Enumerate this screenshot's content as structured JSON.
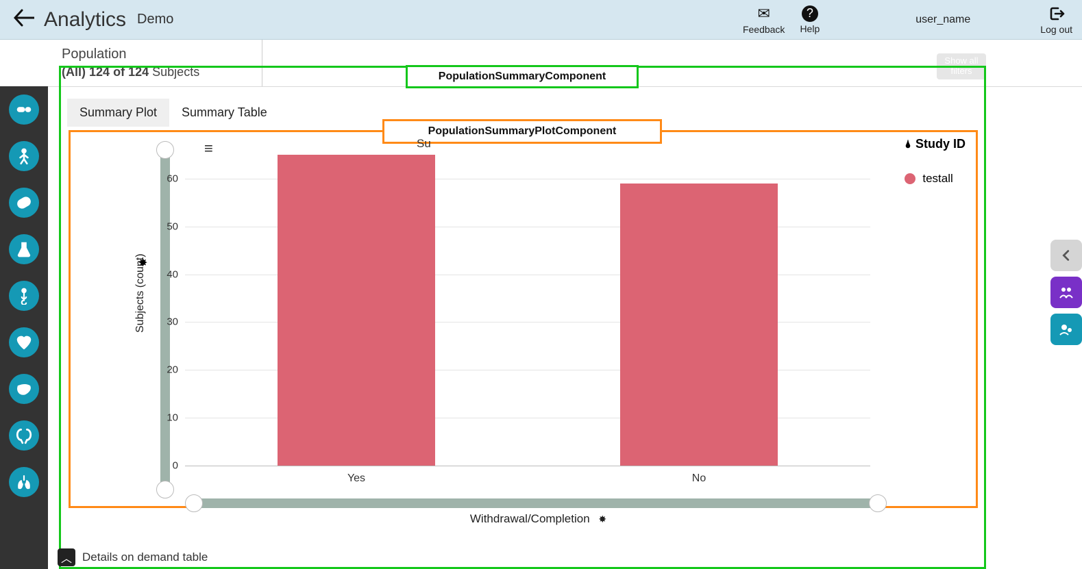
{
  "header": {
    "app_title": "Analytics",
    "context": "Demo",
    "feedback_label": "Feedback",
    "help_label": "Help",
    "user_name": "user_name",
    "logout_label": "Log out"
  },
  "population": {
    "title": "Population",
    "filter_label": "(All)",
    "count": "124",
    "of": "of",
    "total": "124",
    "unit": "Subjects",
    "show_all_filters": "Show all filters"
  },
  "overlays": {
    "outer": "PopulationSummaryComponent",
    "inner": "PopulationSummaryPlotComponent"
  },
  "tabs": {
    "summary_plot": "Summary Plot",
    "summary_table": "Summary Table"
  },
  "chart": {
    "title_visible_prefix": "Su",
    "legend_title": "Study ID",
    "legend_item": "testall",
    "ylabel": "Subjects (count)",
    "xlabel": "Withdrawal/Completion"
  },
  "chart_data": {
    "type": "bar",
    "categories": [
      "Yes",
      "No"
    ],
    "values": [
      65,
      59
    ],
    "series": [
      {
        "name": "testall",
        "values": [
          65,
          59
        ],
        "color": "#dc6473"
      }
    ],
    "title": "Subjects",
    "xlabel": "Withdrawal/Completion",
    "ylabel": "Subjects (count)",
    "ylim": [
      0,
      65
    ],
    "y_ticks": [
      0,
      10,
      20,
      30,
      40,
      50,
      60
    ]
  },
  "dod": {
    "label": "Details on demand table"
  },
  "sidebar": {
    "items": [
      "population",
      "dosing",
      "adverse-events",
      "conmeds",
      "labs",
      "vitals",
      "cardiac",
      "liver",
      "renal",
      "respiratory"
    ]
  },
  "right_panel": {
    "items": [
      "collapse",
      "cohort",
      "subjects"
    ]
  }
}
